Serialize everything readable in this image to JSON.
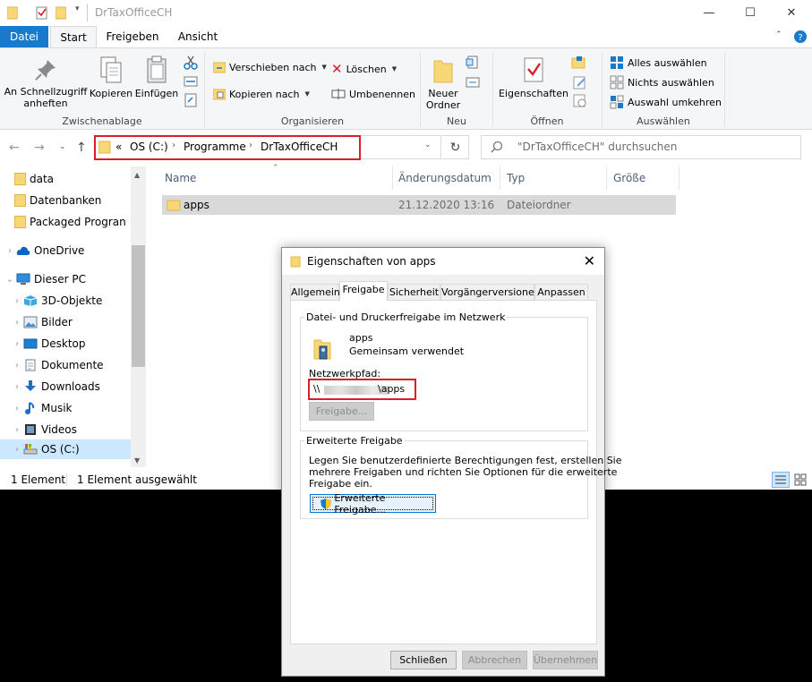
{
  "window": {
    "title": "DrTaxOfficeCH"
  },
  "ribbon_tabs": [
    "Datei",
    "Start",
    "Freigeben",
    "Ansicht"
  ],
  "ribbon": {
    "pin": "An Schnellzugriff\nanheften",
    "copy": "Kopieren",
    "paste": "Einfügen",
    "group_clipboard": "Zwischenablage",
    "move_to": "Verschieben nach",
    "copy_to": "Kopieren nach",
    "delete": "Löschen",
    "rename": "Umbenennen",
    "group_organize": "Organisieren",
    "new_folder": "Neuer\nOrdner",
    "group_new": "Neu",
    "properties": "Eigenschaften",
    "group_open": "Öffnen",
    "select_all": "Alles auswählen",
    "select_none": "Nichts auswählen",
    "invert_selection": "Auswahl umkehren",
    "group_select": "Auswählen"
  },
  "address": {
    "prefix": "«",
    "crumbs": [
      "OS (C:)",
      "Programme",
      "DrTaxOfficeCH"
    ],
    "search_placeholder": "\"DrTaxOfficeCH\" durchsuchen"
  },
  "nav_items": [
    {
      "label": "data",
      "icon": "folder-icon"
    },
    {
      "label": "Datenbanken",
      "icon": "folder-icon"
    },
    {
      "label": "Packaged Progran",
      "icon": "folder-icon"
    },
    {
      "label": "OneDrive",
      "icon": "cloud-icon"
    },
    {
      "label": "Dieser PC",
      "icon": "computer-icon"
    },
    {
      "label": "3D-Objekte",
      "icon": "cube-icon"
    },
    {
      "label": "Bilder",
      "icon": "pictures-icon"
    },
    {
      "label": "Desktop",
      "icon": "desktop-icon"
    },
    {
      "label": "Dokumente",
      "icon": "documents-icon"
    },
    {
      "label": "Downloads",
      "icon": "download-icon"
    },
    {
      "label": "Musik",
      "icon": "music-icon"
    },
    {
      "label": "Videos",
      "icon": "video-icon"
    },
    {
      "label": "OS (C:)",
      "icon": "drive-icon"
    }
  ],
  "columns": [
    "Name",
    "Änderungsdatum",
    "Typ",
    "Größe"
  ],
  "files": [
    {
      "name": "apps",
      "date": "21.12.2020 13:16",
      "type": "Dateiordner",
      "size": ""
    }
  ],
  "status": {
    "count": "1 Element",
    "selected": "1 Element ausgewählt"
  },
  "dialog": {
    "title": "Eigenschaften von apps",
    "tabs": [
      "Allgemein",
      "Freigabe",
      "Sicherheit",
      "Vorgängerversionen",
      "Anpassen"
    ],
    "share_group_title": "Datei- und Druckerfreigabe im Netzwerk",
    "folder_name": "apps",
    "share_state": "Gemeinsam verwendet",
    "netpath_label": "Netzwerkpfad:",
    "netpath_prefix": "\\\\",
    "netpath_suffix": "\\apps",
    "share_button": "Freigabe...",
    "adv_group_title": "Erweiterte Freigabe",
    "adv_desc_1": "Legen Sie benutzerdefinierte Berechtigungen fest, erstellen Sie",
    "adv_desc_2": "mehrere Freigaben und richten Sie Optionen für die erweiterte",
    "adv_desc_3": "Freigabe ein.",
    "adv_button": "Erweiterte Freigabe...",
    "close_button": "Schließen",
    "cancel_button": "Abbrechen",
    "apply_button": "Übernehmen"
  },
  "colors": {
    "accent": "#1979ca",
    "highlight": "#d6202a",
    "selection": "#cce8ff"
  }
}
